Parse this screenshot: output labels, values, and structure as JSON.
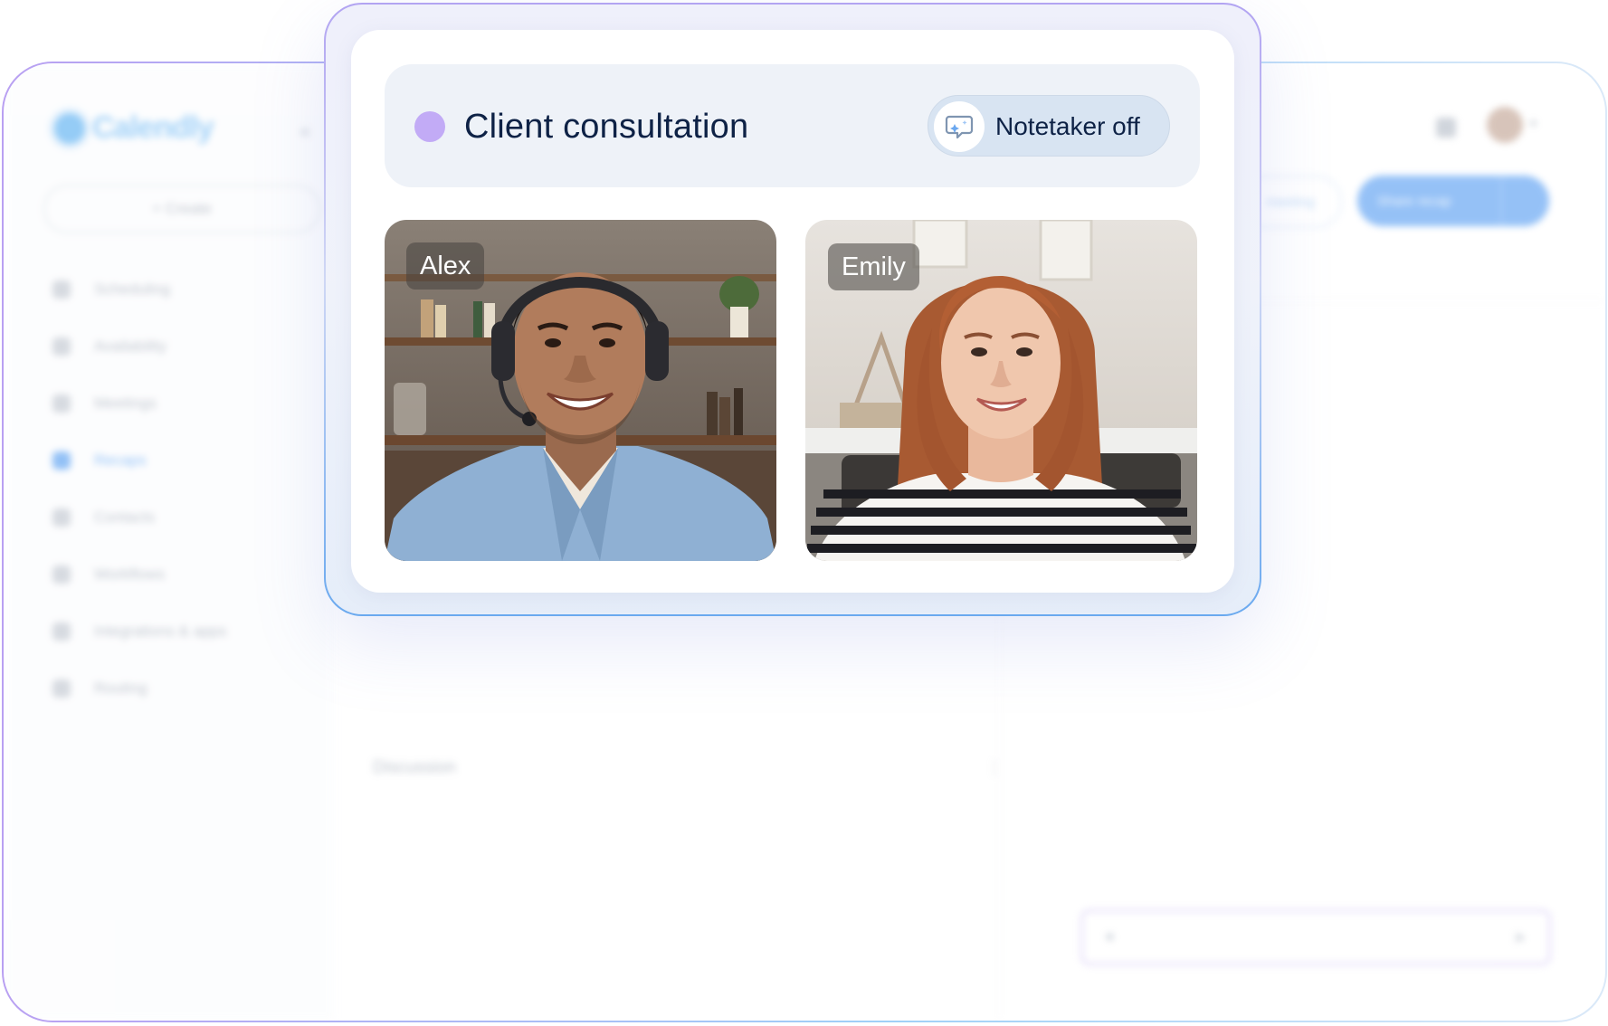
{
  "app": {
    "logo_text": "Calendly",
    "create_label": "+ Create",
    "nav": [
      {
        "label": "Scheduling",
        "icon": "link-icon"
      },
      {
        "label": "Availability",
        "icon": "clock-icon"
      },
      {
        "label": "Meetings",
        "icon": "calendar-icon"
      },
      {
        "label": "Recaps",
        "icon": "recap-icon",
        "active": true
      },
      {
        "label": "Contacts",
        "icon": "contacts-icon"
      },
      {
        "label": "Workflows",
        "icon": "workflow-icon"
      },
      {
        "label": "Integrations & apps",
        "icon": "grid-icon"
      },
      {
        "label": "Routing",
        "icon": "routing-icon"
      }
    ],
    "toolbar": {
      "meeting_label": "meeting",
      "recap_label": "Share recap"
    },
    "discussion_label": "Discussion",
    "colors": {
      "brand": "#3f8ff0",
      "accent": "#c2abf6"
    }
  },
  "call": {
    "title": "Client consultation",
    "notetaker_label": "Notetaker off",
    "notetaker_icon": "notetaker-off-icon",
    "participants": [
      {
        "name": "Alex"
      },
      {
        "name": "Emily"
      }
    ]
  }
}
